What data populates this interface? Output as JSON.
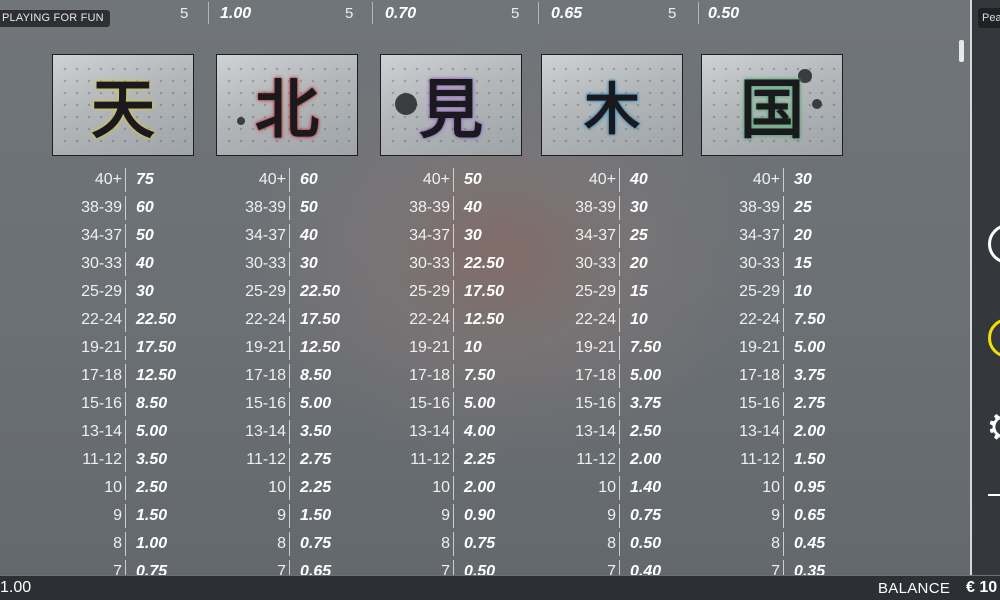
{
  "badge": "PLAYING FOR FUN",
  "right_tab": "Pea",
  "top_row": [
    {
      "count": "5",
      "value": "1.00"
    },
    {
      "count": "5",
      "value": "0.70"
    },
    {
      "count": "5",
      "value": "0.65"
    },
    {
      "count": "5",
      "value": "0.50"
    }
  ],
  "symbols": [
    {
      "icon": "kanji-symbol-1-icon",
      "glyph": "天",
      "rows": [
        {
          "range": "40+",
          "pay": "75"
        },
        {
          "range": "38-39",
          "pay": "60"
        },
        {
          "range": "34-37",
          "pay": "50"
        },
        {
          "range": "30-33",
          "pay": "40"
        },
        {
          "range": "25-29",
          "pay": "30"
        },
        {
          "range": "22-24",
          "pay": "22.50"
        },
        {
          "range": "19-21",
          "pay": "17.50"
        },
        {
          "range": "17-18",
          "pay": "12.50"
        },
        {
          "range": "15-16",
          "pay": "8.50"
        },
        {
          "range": "13-14",
          "pay": "5.00"
        },
        {
          "range": "11-12",
          "pay": "3.50"
        },
        {
          "range": "10",
          "pay": "2.50"
        },
        {
          "range": "9",
          "pay": "1.50"
        },
        {
          "range": "8",
          "pay": "1.00"
        },
        {
          "range": "7",
          "pay": "0.75"
        }
      ]
    },
    {
      "icon": "kanji-symbol-2-icon",
      "glyph": "北",
      "rows": [
        {
          "range": "40+",
          "pay": "60"
        },
        {
          "range": "38-39",
          "pay": "50"
        },
        {
          "range": "34-37",
          "pay": "40"
        },
        {
          "range": "30-33",
          "pay": "30"
        },
        {
          "range": "25-29",
          "pay": "22.50"
        },
        {
          "range": "22-24",
          "pay": "17.50"
        },
        {
          "range": "19-21",
          "pay": "12.50"
        },
        {
          "range": "17-18",
          "pay": "8.50"
        },
        {
          "range": "15-16",
          "pay": "5.00"
        },
        {
          "range": "13-14",
          "pay": "3.50"
        },
        {
          "range": "11-12",
          "pay": "2.75"
        },
        {
          "range": "10",
          "pay": "2.25"
        },
        {
          "range": "9",
          "pay": "1.50"
        },
        {
          "range": "8",
          "pay": "0.75"
        },
        {
          "range": "7",
          "pay": "0.65"
        }
      ]
    },
    {
      "icon": "kanji-symbol-3-icon",
      "glyph": "見",
      "rows": [
        {
          "range": "40+",
          "pay": "50"
        },
        {
          "range": "38-39",
          "pay": "40"
        },
        {
          "range": "34-37",
          "pay": "30"
        },
        {
          "range": "30-33",
          "pay": "22.50"
        },
        {
          "range": "25-29",
          "pay": "17.50"
        },
        {
          "range": "22-24",
          "pay": "12.50"
        },
        {
          "range": "19-21",
          "pay": "10"
        },
        {
          "range": "17-18",
          "pay": "7.50"
        },
        {
          "range": "15-16",
          "pay": "5.00"
        },
        {
          "range": "13-14",
          "pay": "4.00"
        },
        {
          "range": "11-12",
          "pay": "2.25"
        },
        {
          "range": "10",
          "pay": "2.00"
        },
        {
          "range": "9",
          "pay": "0.90"
        },
        {
          "range": "8",
          "pay": "0.75"
        },
        {
          "range": "7",
          "pay": "0.50"
        }
      ]
    },
    {
      "icon": "kanji-symbol-4-icon",
      "glyph": "木",
      "rows": [
        {
          "range": "40+",
          "pay": "40"
        },
        {
          "range": "38-39",
          "pay": "30"
        },
        {
          "range": "34-37",
          "pay": "25"
        },
        {
          "range": "30-33",
          "pay": "20"
        },
        {
          "range": "25-29",
          "pay": "15"
        },
        {
          "range": "22-24",
          "pay": "10"
        },
        {
          "range": "19-21",
          "pay": "7.50"
        },
        {
          "range": "17-18",
          "pay": "5.00"
        },
        {
          "range": "15-16",
          "pay": "3.75"
        },
        {
          "range": "13-14",
          "pay": "2.50"
        },
        {
          "range": "11-12",
          "pay": "2.00"
        },
        {
          "range": "10",
          "pay": "1.40"
        },
        {
          "range": "9",
          "pay": "0.75"
        },
        {
          "range": "8",
          "pay": "0.50"
        },
        {
          "range": "7",
          "pay": "0.40"
        }
      ]
    },
    {
      "icon": "kanji-symbol-5-icon",
      "glyph": "国",
      "rows": [
        {
          "range": "40+",
          "pay": "30"
        },
        {
          "range": "38-39",
          "pay": "25"
        },
        {
          "range": "34-37",
          "pay": "20"
        },
        {
          "range": "30-33",
          "pay": "15"
        },
        {
          "range": "25-29",
          "pay": "10"
        },
        {
          "range": "22-24",
          "pay": "7.50"
        },
        {
          "range": "19-21",
          "pay": "5.00"
        },
        {
          "range": "17-18",
          "pay": "3.75"
        },
        {
          "range": "15-16",
          "pay": "2.75"
        },
        {
          "range": "13-14",
          "pay": "2.00"
        },
        {
          "range": "11-12",
          "pay": "1.50"
        },
        {
          "range": "10",
          "pay": "0.95"
        },
        {
          "range": "9",
          "pay": "0.65"
        },
        {
          "range": "8",
          "pay": "0.45"
        },
        {
          "range": "7",
          "pay": "0.35"
        }
      ]
    }
  ],
  "bottom": {
    "bet_value": "1.00",
    "balance_label": "BALANCE",
    "balance_value": "€ 10"
  },
  "colors": {
    "accent_yellow": "#f2e100",
    "bar_bg": "#2c2f33"
  },
  "icons": {
    "info": "info-ring-icon",
    "autoplay": "autoplay-ring-icon",
    "settings": "gear-icon",
    "menu": "menu-line-icon"
  }
}
